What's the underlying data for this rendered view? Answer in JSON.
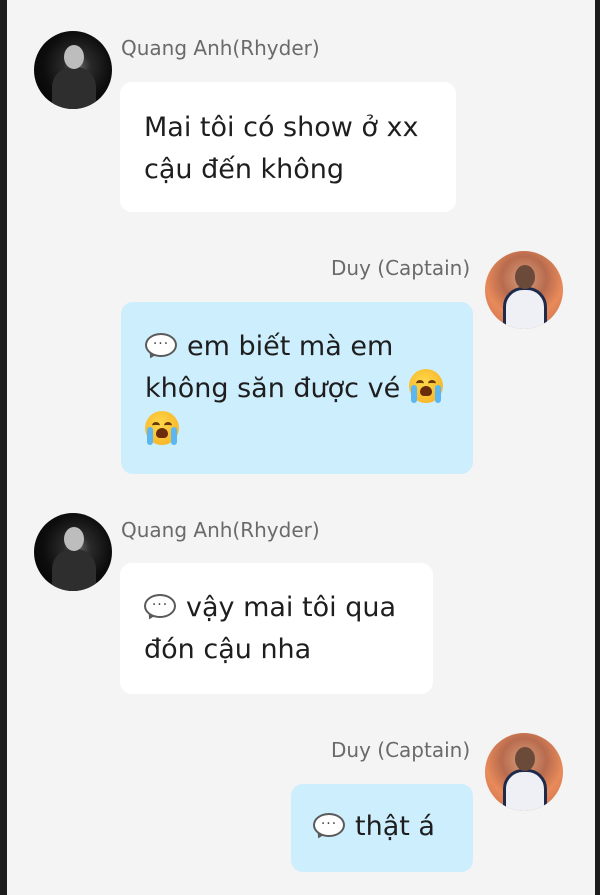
{
  "messages": [
    {
      "sender": "Quang Anh(Rhyder)",
      "avatar": "avatar-dark-portrait",
      "text": "Mai tôi có show ở xx cậu đến không"
    },
    {
      "sender": "Duy (Captain)",
      "avatar": "avatar-light-portrait",
      "line1": "em biết mà em",
      "line2": "không săn được vé",
      "icons": [
        "speech-bubble-icon",
        "crying-face-emoji",
        "crying-face-emoji"
      ]
    },
    {
      "sender": "Quang Anh(Rhyder)",
      "avatar": "avatar-dark-portrait",
      "line1": "vậy mai tôi qua",
      "line2": "đón cậu nha",
      "icons": [
        "speech-bubble-icon"
      ]
    },
    {
      "sender": "Duy (Captain)",
      "avatar": "avatar-light-portrait",
      "text": "thật á",
      "icons": [
        "speech-bubble-icon"
      ]
    }
  ],
  "colors": {
    "background": "#f4f4f4",
    "incoming_bubble": "#ffffff",
    "outgoing_bubble": "#cdeefd",
    "sender_name": "#6a6a6a",
    "message_text": "#1e1e1e"
  }
}
